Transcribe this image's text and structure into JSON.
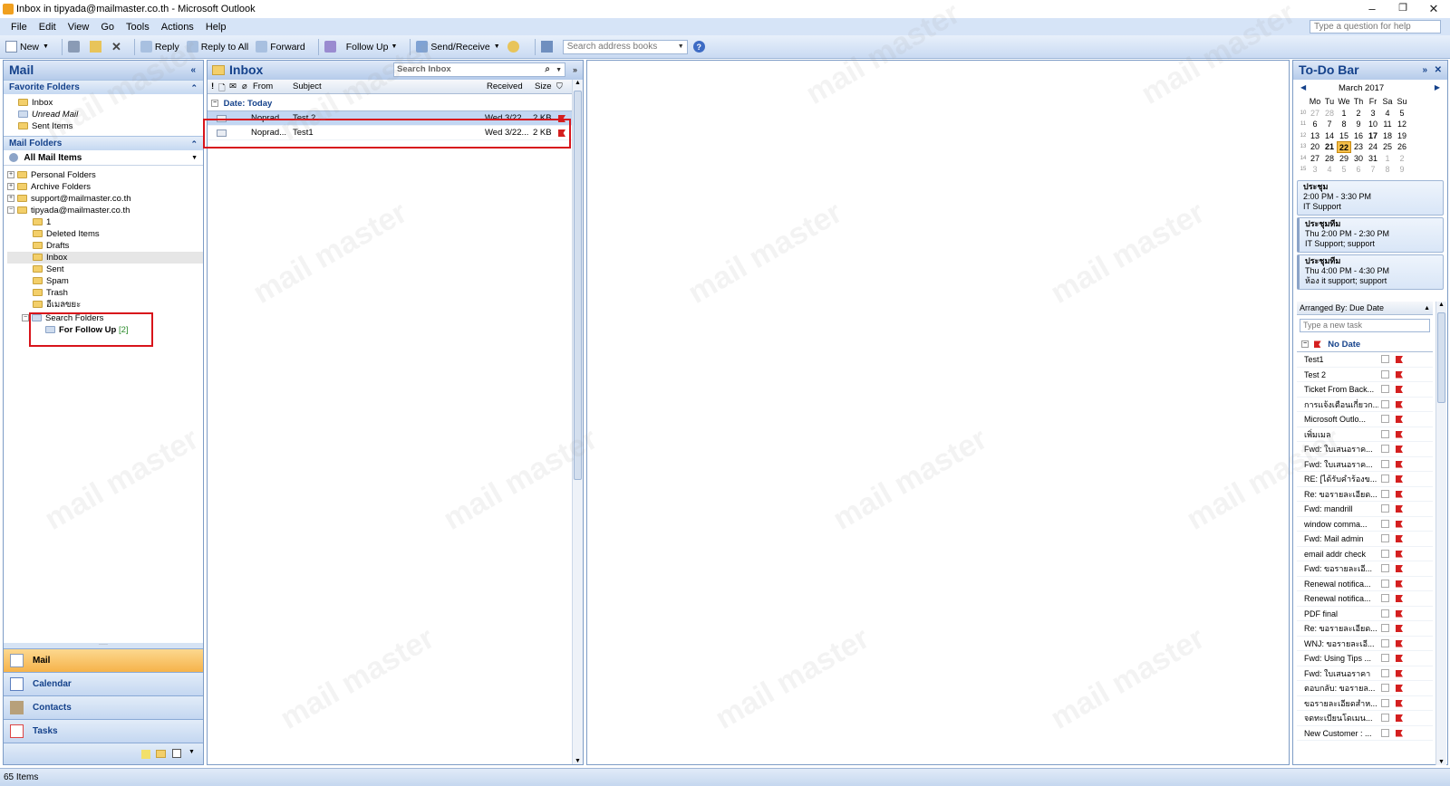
{
  "window": {
    "title": "Inbox in tipyada@mailmaster.co.th - Microsoft Outlook",
    "controls": {
      "minimize": "–",
      "restore": "❐",
      "close": "✕"
    }
  },
  "menu": {
    "items": [
      "File",
      "Edit",
      "View",
      "Go",
      "Tools",
      "Actions",
      "Help"
    ],
    "help_placeholder": "Type a question for help"
  },
  "toolbar": {
    "new_label": "New",
    "reply_label": "Reply",
    "reply_all_label": "Reply to All",
    "forward_label": "Forward",
    "follow_up_label": "Follow Up",
    "send_receive_label": "Send/Receive",
    "address_search_placeholder": "Search address books"
  },
  "nav": {
    "title": "Mail",
    "favorites_header": "Favorite Folders",
    "favorites": [
      "Inbox",
      "Unread Mail",
      "Sent Items"
    ],
    "mail_folders_header": "Mail Folders",
    "all_mail_items": "All Mail Items",
    "top_folders": [
      "Personal Folders",
      "Archive Folders",
      "support@mailmaster.co.th",
      "tipyada@mailmaster.co.th"
    ],
    "sub_folders": [
      "1",
      "Deleted Items",
      "Drafts",
      "Inbox",
      "Sent",
      "Spam",
      "Trash",
      "อีเมลขยะ"
    ],
    "search_folders": "Search Folders",
    "for_follow_up": "For Follow Up",
    "for_follow_up_count": "[2]",
    "buttons": [
      "Mail",
      "Calendar",
      "Contacts",
      "Tasks"
    ]
  },
  "inbox": {
    "title": "Inbox",
    "search_placeholder": "Search Inbox",
    "columns": {
      "from": "From",
      "subject": "Subject",
      "received": "Received",
      "size": "Size"
    },
    "group_label": "Date: Today",
    "messages": [
      {
        "from": "Noprad...",
        "subject": "Test 2",
        "received": "Wed 3/22...",
        "size": "2 KB"
      },
      {
        "from": "Noprad...",
        "subject": "Test1",
        "received": "Wed 3/22...",
        "size": "2 KB"
      }
    ]
  },
  "todo": {
    "title": "To-Do Bar",
    "calendar": {
      "month": "March 2017",
      "weekdays": [
        "Mo",
        "Tu",
        "We",
        "Th",
        "Fr",
        "Sa",
        "Su"
      ],
      "weeks": [
        {
          "wk": "10",
          "days": [
            "27",
            "28",
            "1",
            "2",
            "3",
            "4",
            "5"
          ]
        },
        {
          "wk": "11",
          "days": [
            "6",
            "7",
            "8",
            "9",
            "10",
            "11",
            "12"
          ]
        },
        {
          "wk": "12",
          "days": [
            "13",
            "14",
            "15",
            "16",
            "17",
            "18",
            "19"
          ]
        },
        {
          "wk": "13",
          "days": [
            "20",
            "21",
            "22",
            "23",
            "24",
            "25",
            "26"
          ]
        },
        {
          "wk": "14",
          "days": [
            "27",
            "28",
            "29",
            "30",
            "31",
            "1",
            "2"
          ]
        },
        {
          "wk": "15",
          "days": [
            "3",
            "4",
            "5",
            "6",
            "7",
            "8",
            "9"
          ]
        }
      ],
      "today": "22"
    },
    "appointments": [
      {
        "title": "ประชุม",
        "time": "2:00 PM - 3:30 PM",
        "location": "IT Support"
      },
      {
        "title": "ประชุมทีม",
        "time": "Thu 2:00 PM - 2:30 PM",
        "location": "IT Support; support"
      },
      {
        "title": "ประชุมทีม",
        "time": "Thu 4:00 PM - 4:30 PM",
        "location": "ห้อง it support; support"
      }
    ],
    "arranged_by": "Arranged By: Due Date",
    "new_task_placeholder": "Type a new task",
    "no_date_label": "No Date",
    "tasks": [
      "Test1",
      "Test 2",
      "Ticket From Back...",
      "การแจ้งเตือนเกี่ยวก...",
      "Microsoft Outlo...",
      "เพิ่มเมล",
      "Fwd: ใบเสนอราค...",
      "Fwd: ใบเสนอราค...",
      "RE: [ได้รับคำร้องข...",
      "Re: ขอรายละเอียด...",
      "Fwd: mandrill",
      "window comma...",
      "Fwd: Mail admin",
      "email addr check",
      "Fwd: ขอรายละเอี...",
      "Renewal notifica...",
      "Renewal notifica...",
      "PDF final",
      "Re: ขอรายละเอียด...",
      "WNJ: ขอรายละเอี...",
      "Fwd: Using Tips ...",
      "Fwd: ใบเสนอราคา",
      "ตอบกลับ: ขอรายล...",
      "ขอรายละเอียดสำห...",
      "จดทะเบียนโดเมน...",
      "New Customer : ..."
    ]
  },
  "status": {
    "items": "65 Items"
  },
  "watermark": "mail master",
  "colors": {
    "accent": "#15428b",
    "highlight": "#d8141b",
    "active_nav": "#f6b34a",
    "flag": "#d41f1f"
  }
}
